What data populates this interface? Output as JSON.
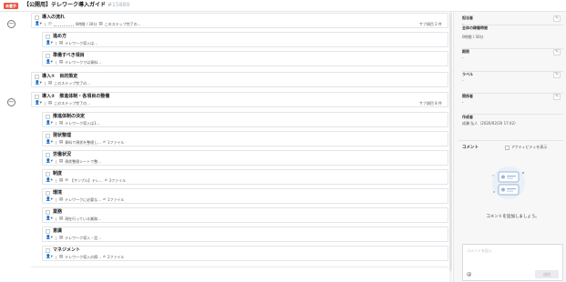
{
  "header": {
    "status_badge": "未着手",
    "title": "【公開用】テレワーク導入ガイド",
    "doc_id": "#15889"
  },
  "groups": [
    {
      "toggle": "−",
      "title": "導入の流れ",
      "meta": "0時間 / 30分",
      "progress": "このステップ完了の…",
      "sub_count": "サブ項目 2 件",
      "children": [
        {
          "title": "進め方",
          "meta": "テレワーク導入は…",
          "files": ""
        },
        {
          "title": "準備すべき項目",
          "meta": "テレワークでは資料…",
          "files": ""
        }
      ]
    },
    {
      "toggle": "",
      "title": "導入①　目的策定",
      "meta": "",
      "progress": "このステップ完了の…",
      "sub_count": "",
      "children": []
    },
    {
      "toggle": "−",
      "title": "導入②　推進体制・各項目の整備",
      "meta": "",
      "progress": "このステップ完了の…",
      "sub_count": "サブ項目 8 件",
      "children": [
        {
          "title": "推進体制の決定",
          "meta": "テレワーク導入は1…",
          "files": ""
        },
        {
          "title": "現状整理",
          "meta": "資料で現状を整理し…",
          "files": "1ファイル"
        },
        {
          "title": "労働状況",
          "meta": "現状整理シートで整…",
          "files": ""
        },
        {
          "title": "制度",
          "meta": "【サンプル】テレ…",
          "files": "3ファイル"
        },
        {
          "title": "環境",
          "meta": "テレワークに必要な…",
          "files": "1ファイル"
        },
        {
          "title": "業務",
          "meta": "現在行っている業務…",
          "files": ""
        },
        {
          "title": "意識",
          "meta": "テレワーク導入・定…",
          "files": ""
        },
        {
          "title": "マネジメント",
          "meta": "テレワーク導入の際…",
          "files": "2ファイル"
        }
      ]
    }
  ],
  "sidebar": {
    "fields": [
      {
        "label": "担当者",
        "value": "-"
      },
      {
        "label": "全体の稼働時間",
        "value": "0時間 / 30分"
      },
      {
        "label": "期限",
        "value": "-"
      },
      {
        "label": "ラベル",
        "value": "-"
      },
      {
        "label": "関係者",
        "value": "-"
      },
      {
        "label": "作成者",
        "value": "成瀬 弘人（2020/02/20 17:42）"
      }
    ],
    "comment_heading": "コメント",
    "activity_label": "アクティビティを表示",
    "empty_text": "コメントを追加しましょう。",
    "comment_placeholder": "コメントを記入",
    "mention": "@",
    "post_label": "送信"
  },
  "colors": {
    "badge": "#e8553f",
    "accent": "#9ab6d8"
  }
}
